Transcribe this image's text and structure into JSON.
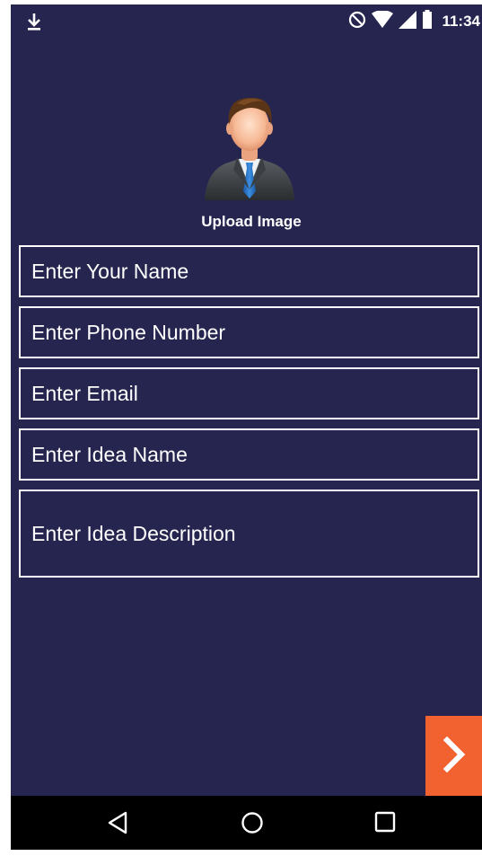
{
  "status_bar": {
    "time": "11:34",
    "icons": [
      "download-icon",
      "do-not-disturb-icon",
      "wifi-icon",
      "signal-icon",
      "battery-icon"
    ]
  },
  "profile": {
    "avatar_icon": "person-avatar-icon",
    "upload_label": "Upload Image"
  },
  "form": {
    "name_placeholder": "Enter Your Name",
    "phone_placeholder": "Enter Phone Number",
    "email_placeholder": "Enter Email",
    "idea_name_placeholder": "Enter Idea Name",
    "idea_description_placeholder": "Enter Idea Description"
  },
  "actions": {
    "next_icon": "chevron-right-icon"
  },
  "nav_bar": {
    "icons": [
      "back-icon",
      "home-icon",
      "recents-icon"
    ]
  },
  "colors": {
    "background": "#26254f",
    "accent": "#f26230",
    "text": "#ffffff",
    "nav_bar": "#000000"
  }
}
